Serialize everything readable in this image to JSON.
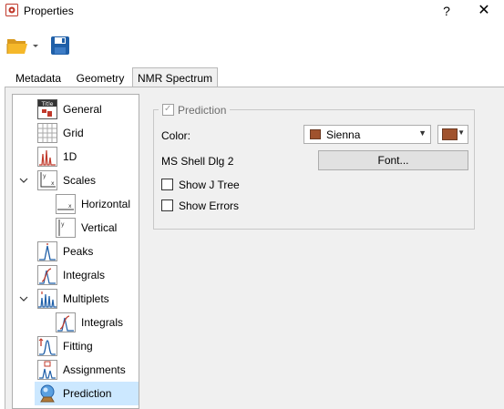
{
  "window": {
    "title": "Properties",
    "help_label": "?",
    "close_label": "✕"
  },
  "toolbar": {
    "open_icon": "folder-open-icon",
    "save_icon": "save-icon"
  },
  "tabs": [
    {
      "label": "Metadata",
      "active": false
    },
    {
      "label": "Geometry",
      "active": false
    },
    {
      "label": "NMR Spectrum",
      "active": true
    }
  ],
  "tree": {
    "items": [
      {
        "label": "General",
        "icon": "title-general-icon",
        "selected": false
      },
      {
        "label": "Grid",
        "icon": "grid-icon",
        "selected": false
      },
      {
        "label": "1D",
        "icon": "spectrum-1d-icon",
        "selected": false
      },
      {
        "label": "Scales",
        "icon": "scales-icon",
        "expanded": true,
        "selected": false
      },
      {
        "label": "Horizontal",
        "icon": "horizontal-scale-icon",
        "selected": false
      },
      {
        "label": "Vertical",
        "icon": "vertical-scale-icon",
        "selected": false
      },
      {
        "label": "Peaks",
        "icon": "peaks-icon",
        "selected": false
      },
      {
        "label": "Integrals",
        "icon": "integrals-icon",
        "selected": false
      },
      {
        "label": "Multiplets",
        "icon": "multiplets-icon",
        "expanded": true,
        "selected": false
      },
      {
        "label": "Integrals",
        "icon": "integrals-icon",
        "selected": false
      },
      {
        "label": "Fitting",
        "icon": "fitting-icon",
        "selected": false
      },
      {
        "label": "Assignments",
        "icon": "assignments-icon",
        "selected": false
      },
      {
        "label": "Prediction",
        "icon": "prediction-icon",
        "selected": true
      }
    ]
  },
  "prediction": {
    "group_label": "Prediction",
    "enabled": true,
    "color_label": "Color:",
    "color_value": "Sienna",
    "color_hex": "#a0522d",
    "font_name": "MS Shell Dlg 2",
    "font_button": "Font...",
    "show_j_tree": {
      "label": "Show J Tree",
      "checked": false
    },
    "show_errors": {
      "label": "Show Errors",
      "checked": false
    }
  }
}
